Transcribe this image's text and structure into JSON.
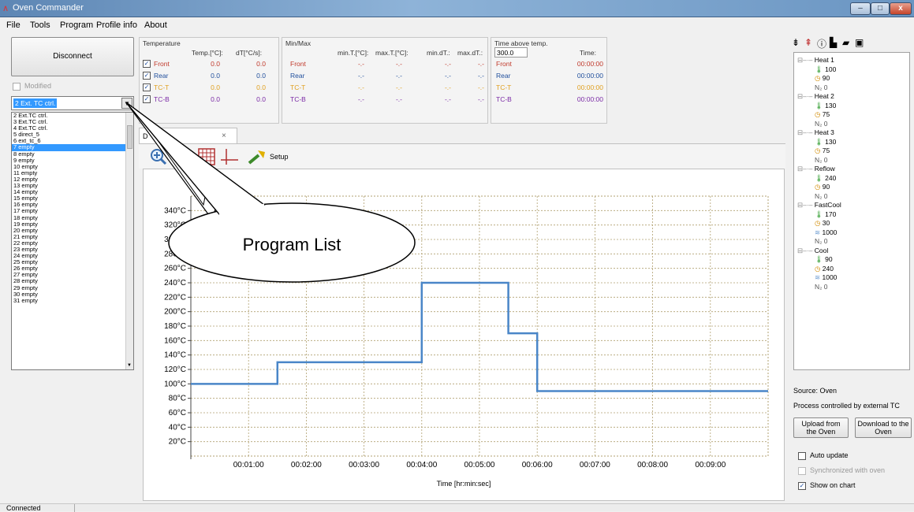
{
  "window": {
    "title": "Oven Commander",
    "minimize": "–",
    "maximize": "□",
    "close": "x"
  },
  "menu": [
    "File",
    "Tools",
    "Program",
    "Profile info",
    "About"
  ],
  "left": {
    "disconnect_label": "Disconnect",
    "modified_label": "Modified",
    "program_select_value": "2 Ext. TC ctrl.",
    "program_list": [
      "2 Ext.TC ctrl.",
      "3 Ext.TC ctrl.",
      "4 Ext.TC ctrl.",
      "5 direct_5",
      "6 ext_tc_6",
      "7 empty",
      "8 empty",
      "9 empty",
      "10 empty",
      "11 empty",
      "12 empty",
      "13 empty",
      "14 empty",
      "15 empty",
      "16 empty",
      "17 empty",
      "18 empty",
      "19 empty",
      "20 empty",
      "21 empty",
      "22 empty",
      "23 empty",
      "24 empty",
      "25 empty",
      "26 empty",
      "27 empty",
      "28 empty",
      "29 empty",
      "30 empty",
      "31 empty"
    ],
    "selected_index": 5
  },
  "temperature": {
    "title": "Temperature",
    "col_temp": "Temp.[°C]:",
    "col_dt": "dT[°C/s]:",
    "rows": [
      {
        "name": "Front",
        "temp": "0.0",
        "dt": "0.0",
        "color": "#c0392b"
      },
      {
        "name": "Rear",
        "temp": "0.0",
        "dt": "0.0",
        "color": "#1f4e9c"
      },
      {
        "name": "TC-T",
        "temp": "0.0",
        "dt": "0.0",
        "color": "#e0a020"
      },
      {
        "name": "TC-B",
        "temp": "0.0",
        "dt": "0.0",
        "color": "#7b2aa6"
      }
    ]
  },
  "minmax": {
    "title": "Min/Max",
    "cols": [
      "min.T.[°C]:",
      "max.T.[°C]:",
      "min.dT.:",
      "max.dT.:"
    ],
    "rows": [
      {
        "name": "Front",
        "vals": [
          "-.-",
          "-.-",
          "-.-",
          "-.-"
        ]
      },
      {
        "name": "Rear",
        "vals": [
          "-.-",
          "-.-",
          "-.-",
          "-.-"
        ]
      },
      {
        "name": "TC-T",
        "vals": [
          "-.-",
          "-.-",
          "-.-",
          "-.-"
        ]
      },
      {
        "name": "TC-B",
        "vals": [
          "-.-",
          "-.-",
          "-.-",
          "-.-"
        ]
      }
    ]
  },
  "time_above": {
    "title": "Time above temp.",
    "threshold": "300.0",
    "col_time": "Time:",
    "rows": [
      {
        "name": "Front",
        "time": "00:00:00"
      },
      {
        "name": "Rear",
        "time": "00:00:00"
      },
      {
        "name": "TC-T",
        "time": "00:00:00"
      },
      {
        "name": "TC-B",
        "time": "00:00:00"
      }
    ]
  },
  "chart_tab": {
    "label": "D",
    "close": "×"
  },
  "chart_toolbar": {
    "setup_label": "Setup"
  },
  "callout": {
    "text": "Program List"
  },
  "chart_data": {
    "type": "line",
    "xlabel": "Time [hr:min:sec]",
    "ylabel": "",
    "y_ticks": [
      "20°C",
      "40°C",
      "60°C",
      "80°C",
      "100°C",
      "120°C",
      "140°C",
      "160°C",
      "180°C",
      "200°C",
      "220°C",
      "240°C",
      "260°C",
      "280°C",
      "300°C",
      "320°C",
      "340°C"
    ],
    "y_tick_values": [
      20,
      40,
      60,
      80,
      100,
      120,
      140,
      160,
      180,
      200,
      220,
      240,
      260,
      280,
      300,
      320,
      340
    ],
    "x_ticks": [
      "00:01:00",
      "00:02:00",
      "00:03:00",
      "00:04:00",
      "00:05:00",
      "00:06:00",
      "00:07:00",
      "00:08:00",
      "00:09:00"
    ],
    "x_tick_values": [
      60,
      120,
      180,
      240,
      300,
      360,
      420,
      480,
      540
    ],
    "xlim": [
      0,
      600
    ],
    "ylim": [
      0,
      360
    ],
    "grid": true,
    "series": [
      {
        "color": "#4a86c8",
        "x": [
          0,
          90,
          90,
          240,
          240,
          330,
          330,
          360,
          360,
          600
        ],
        "y": [
          100,
          100,
          130,
          130,
          240,
          240,
          170,
          170,
          90,
          90
        ]
      }
    ]
  },
  "tree": {
    "toolbar_icons": [
      "collapse-icon",
      "expand-icon",
      "info-icon",
      "new-file-icon",
      "open-folder-icon",
      "save-icon"
    ],
    "steps": [
      {
        "name": "Heat 1",
        "temp": "100",
        "time": "90",
        "n2": "N₂ 0"
      },
      {
        "name": "Heat 2",
        "temp": "130",
        "time": "75",
        "n2": "N₂ 0"
      },
      {
        "name": "Heat 3",
        "temp": "130",
        "time": "75",
        "n2": "N₂ 0"
      },
      {
        "name": "Reflow",
        "temp": "240",
        "time": "90",
        "n2": "N₂ 0"
      },
      {
        "name": "FastCool",
        "temp": "170",
        "time": "30",
        "fan": "1000",
        "n2": "N₂ 0"
      },
      {
        "name": "Cool",
        "temp": "90",
        "time": "240",
        "fan": "1000",
        "n2": "N₂ 0"
      }
    ]
  },
  "right": {
    "source": "Source: Oven",
    "process": "Process controlled by external TC",
    "upload_label": "Upload from the Oven",
    "download_label": "Download to the Oven",
    "auto_update": "Auto update",
    "synchronized": "Synchronized with oven",
    "show_on_chart": "Show on chart"
  },
  "status": {
    "text": "Connected"
  }
}
